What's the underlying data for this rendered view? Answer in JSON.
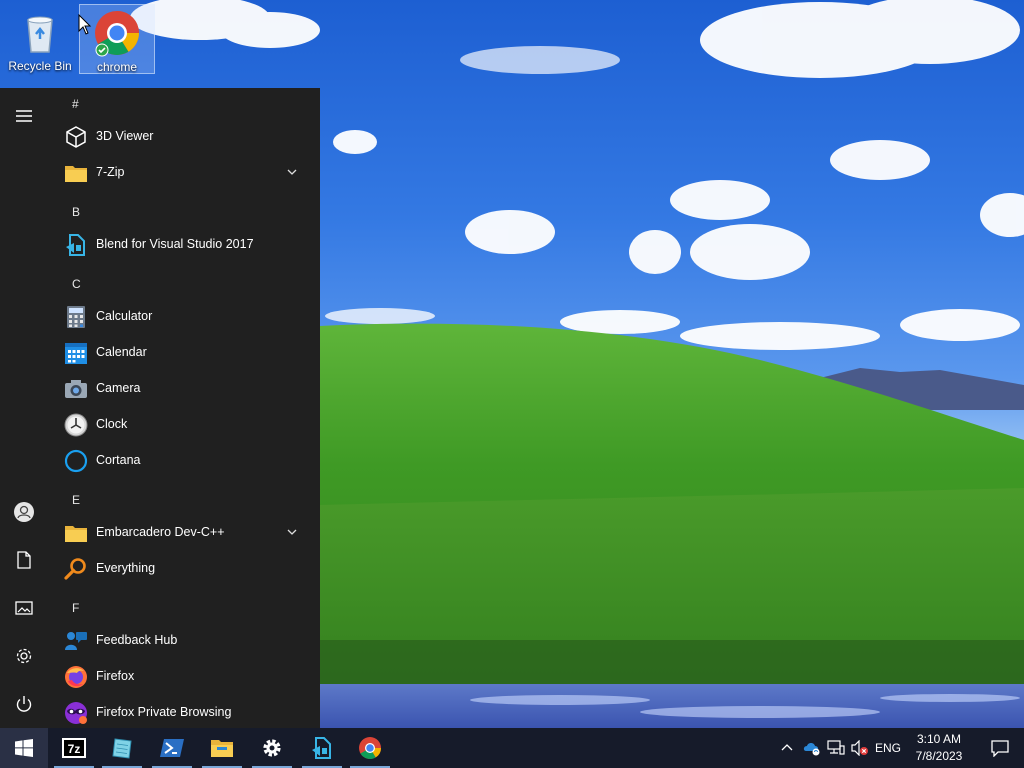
{
  "desktop": {
    "icons": [
      {
        "label": "Recycle Bin",
        "icon": "recycle-bin-icon"
      },
      {
        "label": "chrome",
        "icon": "chrome-icon"
      }
    ]
  },
  "start_menu": {
    "rail": [
      "hamburger-icon",
      "user-icon",
      "documents-icon",
      "pictures-icon",
      "settings-icon",
      "power-icon"
    ],
    "headers": [
      "#",
      "B",
      "C",
      "E",
      "F"
    ],
    "apps": [
      {
        "name": "3D Viewer",
        "icon": "3d-viewer-icon"
      },
      {
        "name": "7-Zip",
        "icon": "folder-icon",
        "expandable": true
      },
      {
        "name": "Blend for Visual Studio 2017",
        "icon": "blend-icon"
      },
      {
        "name": "Calculator",
        "icon": "calculator-icon"
      },
      {
        "name": "Calendar",
        "icon": "calendar-icon"
      },
      {
        "name": "Camera",
        "icon": "camera-icon"
      },
      {
        "name": "Clock",
        "icon": "clock-icon"
      },
      {
        "name": "Cortana",
        "icon": "cortana-icon"
      },
      {
        "name": "Embarcadero Dev-C++",
        "icon": "folder-icon",
        "expandable": true
      },
      {
        "name": "Everything",
        "icon": "everything-search-icon"
      },
      {
        "name": "Feedback Hub",
        "icon": "feedback-hub-icon"
      },
      {
        "name": "Firefox",
        "icon": "firefox-icon"
      },
      {
        "name": "Firefox Private Browsing",
        "icon": "firefox-private-icon"
      }
    ]
  },
  "taskbar": {
    "pinned": [
      "start-icon",
      "7zip-icon",
      "notepad-icon",
      "powershell-icon",
      "file-explorer-icon",
      "settings-icon",
      "blend-icon",
      "chrome-icon"
    ],
    "tray": {
      "language": "ENG",
      "time": "3:10 AM",
      "date": "7/8/2023"
    }
  },
  "colors": {
    "menu_bg": "#202020",
    "taskbar_bg": "#161b2a",
    "accent": "#0078d7"
  }
}
